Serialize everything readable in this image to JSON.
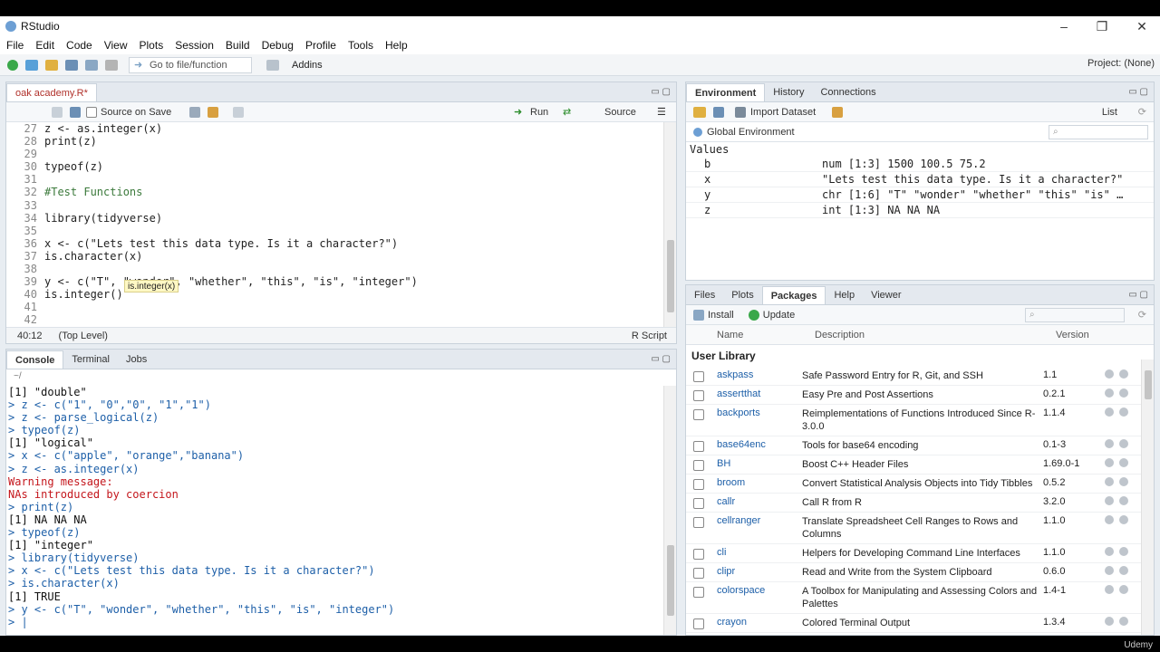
{
  "app_title": "RStudio",
  "menu": [
    "File",
    "Edit",
    "Code",
    "View",
    "Plots",
    "Session",
    "Build",
    "Debug",
    "Profile",
    "Tools",
    "Help"
  ],
  "toolbar": {
    "goto_placeholder": "Go to file/function",
    "addins": "Addins",
    "project": "Project: (None)"
  },
  "editor": {
    "tab": "oak academy.R*",
    "source_on_save": "Source on Save",
    "run": "Run",
    "source": "Source",
    "lines": [
      {
        "n": "27",
        "t": "z <- as.integer(x)"
      },
      {
        "n": "28",
        "t": "print(z)"
      },
      {
        "n": "29",
        "t": ""
      },
      {
        "n": "30",
        "t": "typeof(z)"
      },
      {
        "n": "31",
        "t": ""
      },
      {
        "n": "32",
        "t": "#Test Functions"
      },
      {
        "n": "33",
        "t": ""
      },
      {
        "n": "34",
        "t": "library(tidyverse)"
      },
      {
        "n": "35",
        "t": ""
      },
      {
        "n": "36",
        "t": "x <- c(\"Lets test this data type. Is it a character?\")"
      },
      {
        "n": "37",
        "t": "is.character(x)"
      },
      {
        "n": "38",
        "t": ""
      },
      {
        "n": "39",
        "t": "y <- c(\"T\", \"wonder\", \"whether\", \"this\", \"is\", \"integer\")"
      },
      {
        "n": "40",
        "t": "is.integer()"
      },
      {
        "n": "41",
        "t": ""
      },
      {
        "n": "42",
        "t": ""
      }
    ],
    "tooltip": "is.integer(x)",
    "cursor_pos": "40:12",
    "scope": "(Top Level)",
    "filetype": "R Script"
  },
  "console": {
    "tabs": [
      "Console",
      "Terminal",
      "Jobs"
    ],
    "path": "~/",
    "lines": [
      {
        "k": "out",
        "t": "[1] \"double\""
      },
      {
        "k": "prompt",
        "t": "> z <- c(\"1\", \"0\",\"0\", \"1\",\"1\")"
      },
      {
        "k": "prompt",
        "t": "> z <- parse_logical(z)"
      },
      {
        "k": "prompt",
        "t": "> typeof(z)"
      },
      {
        "k": "out",
        "t": "[1] \"logical\""
      },
      {
        "k": "prompt",
        "t": "> x <- c(\"apple\", \"orange\",\"banana\")"
      },
      {
        "k": "prompt",
        "t": "> z <- as.integer(x)"
      },
      {
        "k": "err",
        "t": "Warning message:"
      },
      {
        "k": "err",
        "t": "NAs introduced by coercion"
      },
      {
        "k": "prompt",
        "t": "> print(z)"
      },
      {
        "k": "out",
        "t": "[1] NA NA NA"
      },
      {
        "k": "prompt",
        "t": "> typeof(z)"
      },
      {
        "k": "out",
        "t": "[1] \"integer\""
      },
      {
        "k": "prompt",
        "t": "> library(tidyverse)"
      },
      {
        "k": "prompt",
        "t": "> x <- c(\"Lets test this data type. Is it a character?\")"
      },
      {
        "k": "prompt",
        "t": "> is.character(x)"
      },
      {
        "k": "out",
        "t": "[1] TRUE"
      },
      {
        "k": "prompt",
        "t": "> y <- c(\"T\", \"wonder\", \"whether\", \"this\", \"is\", \"integer\")"
      },
      {
        "k": "prompt",
        "t": "> |"
      }
    ]
  },
  "environment": {
    "tabs": [
      "Environment",
      "History",
      "Connections"
    ],
    "import_dataset": "Import Dataset",
    "view_mode": "List",
    "scope": "Global Environment",
    "section": "Values",
    "rows": [
      {
        "name": "b",
        "value": "num [1:3] 1500 100.5 75.2"
      },
      {
        "name": "x",
        "value": "\"Lets test this data type. Is it a character?\""
      },
      {
        "name": "y",
        "value": "chr [1:6] \"T\" \"wonder\" \"whether\" \"this\" \"is\" …"
      },
      {
        "name": "z",
        "value": "int [1:3] NA NA NA"
      }
    ]
  },
  "packages": {
    "tabs": [
      "Files",
      "Plots",
      "Packages",
      "Help",
      "Viewer"
    ],
    "install": "Install",
    "update": "Update",
    "headers": {
      "name": "Name",
      "description": "Description",
      "version": "Version"
    },
    "section": "User Library",
    "rows": [
      {
        "name": "askpass",
        "desc": "Safe Password Entry for R, Git, and SSH",
        "ver": "1.1"
      },
      {
        "name": "assertthat",
        "desc": "Easy Pre and Post Assertions",
        "ver": "0.2.1"
      },
      {
        "name": "backports",
        "desc": "Reimplementations of Functions Introduced Since R-3.0.0",
        "ver": "1.1.4"
      },
      {
        "name": "base64enc",
        "desc": "Tools for base64 encoding",
        "ver": "0.1-3"
      },
      {
        "name": "BH",
        "desc": "Boost C++ Header Files",
        "ver": "1.69.0-1"
      },
      {
        "name": "broom",
        "desc": "Convert Statistical Analysis Objects into Tidy Tibbles",
        "ver": "0.5.2"
      },
      {
        "name": "callr",
        "desc": "Call R from R",
        "ver": "3.2.0"
      },
      {
        "name": "cellranger",
        "desc": "Translate Spreadsheet Cell Ranges to Rows and Columns",
        "ver": "1.1.0"
      },
      {
        "name": "cli",
        "desc": "Helpers for Developing Command Line Interfaces",
        "ver": "1.1.0"
      },
      {
        "name": "clipr",
        "desc": "Read and Write from the System Clipboard",
        "ver": "0.6.0"
      },
      {
        "name": "colorspace",
        "desc": "A Toolbox for Manipulating and Assessing Colors and Palettes",
        "ver": "1.4-1"
      },
      {
        "name": "crayon",
        "desc": "Colored Terminal Output",
        "ver": "1.3.4"
      }
    ]
  },
  "watermark": "Udemy"
}
